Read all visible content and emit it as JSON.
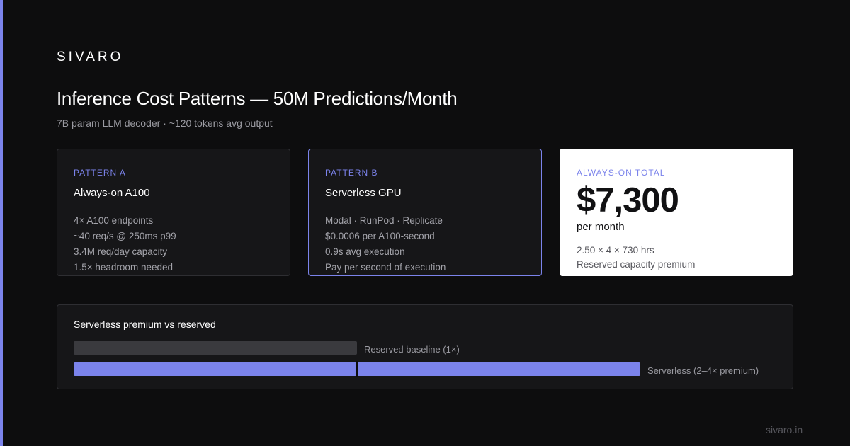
{
  "brand": "SIVARO",
  "title": "Inference Cost Patterns — 50M Predictions/Month",
  "subtitle": "7B param LLM decoder · ~120 tokens avg output",
  "colors": {
    "accent": "#7b83eb",
    "background": "#0d0d0e",
    "card": "#161618",
    "highlight_card": "#ffffff"
  },
  "cards": [
    {
      "label": "PATTERN A",
      "title": "Always-on A100",
      "lines": [
        "4× A100 endpoints",
        "~40 req/s @ 250ms p99",
        "3.4M req/day capacity",
        "1.5× headroom needed"
      ]
    },
    {
      "label": "PATTERN B",
      "title": "Serverless GPU",
      "lines": [
        "Modal · RunPod · Replicate",
        "$0.0006 per A100-second",
        "0.9s avg execution",
        "Pay per second of execution"
      ]
    }
  ],
  "total": {
    "label": "ALWAYS-ON TOTAL",
    "value": "$7,300",
    "unit": "per month",
    "lines": [
      "2.50 × 4 × 730 hrs",
      "Reserved capacity premium"
    ]
  },
  "comparison": {
    "title": "Serverless premium vs reserved",
    "bars": [
      {
        "label": "Reserved baseline (1×)",
        "relative": 1
      },
      {
        "label": "Serverless (2–4× premium)",
        "relative": 2
      }
    ]
  },
  "footer": "sivaro.in"
}
